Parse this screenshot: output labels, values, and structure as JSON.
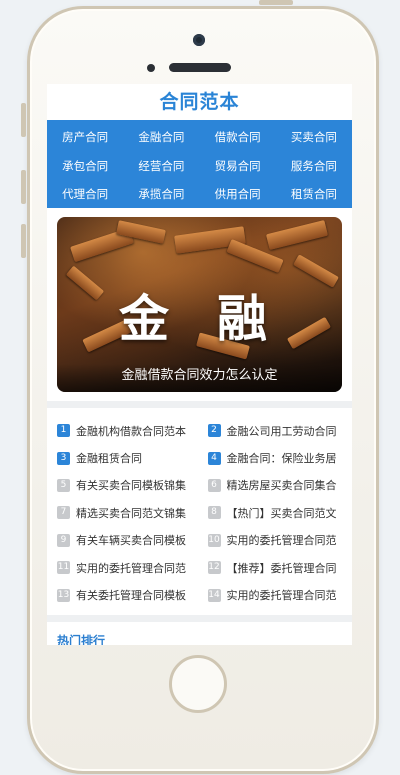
{
  "site": {
    "title": "合同范本"
  },
  "nav": [
    "房产合同",
    "金融合同",
    "借款合同",
    "买卖合同",
    "承包合同",
    "经营合同",
    "贸易合同",
    "服务合同",
    "代理合同",
    "承揽合同",
    "供用合同",
    "租赁合同"
  ],
  "banner": {
    "big_left": "金",
    "big_right": "融",
    "caption": "金融借款合同效力怎么认定"
  },
  "list": [
    {
      "num": "1",
      "text": "金融机构借款合同范本"
    },
    {
      "num": "2",
      "text": "金融公司用工劳动合同"
    },
    {
      "num": "3",
      "text": "金融租赁合同"
    },
    {
      "num": "4",
      "text": "金融合同：保险业务居"
    },
    {
      "num": "5",
      "text": "有关买卖合同模板锦集"
    },
    {
      "num": "6",
      "text": "精选房屋买卖合同集合"
    },
    {
      "num": "7",
      "text": "精选买卖合同范文锦集"
    },
    {
      "num": "8",
      "text": "【热门】买卖合同范文"
    },
    {
      "num": "9",
      "text": "有关车辆买卖合同模板"
    },
    {
      "num": "10",
      "text": "实用的委托管理合同范"
    },
    {
      "num": "11",
      "text": "实用的委托管理合同范"
    },
    {
      "num": "12",
      "text": "【推荐】委托管理合同"
    },
    {
      "num": "13",
      "text": "有关委托管理合同模板"
    },
    {
      "num": "14",
      "text": "实用的委托管理合同范"
    }
  ],
  "hot": {
    "heading": "热门排行"
  },
  "colors": {
    "accent": "#2c85d8",
    "title": "#2a84d6",
    "rank_top": "#2c85d8",
    "rank_other": "#c7c9cc"
  },
  "icons": {
    "camera": "camera-icon",
    "speaker": "speaker-grille-icon",
    "home": "home-button-icon"
  }
}
